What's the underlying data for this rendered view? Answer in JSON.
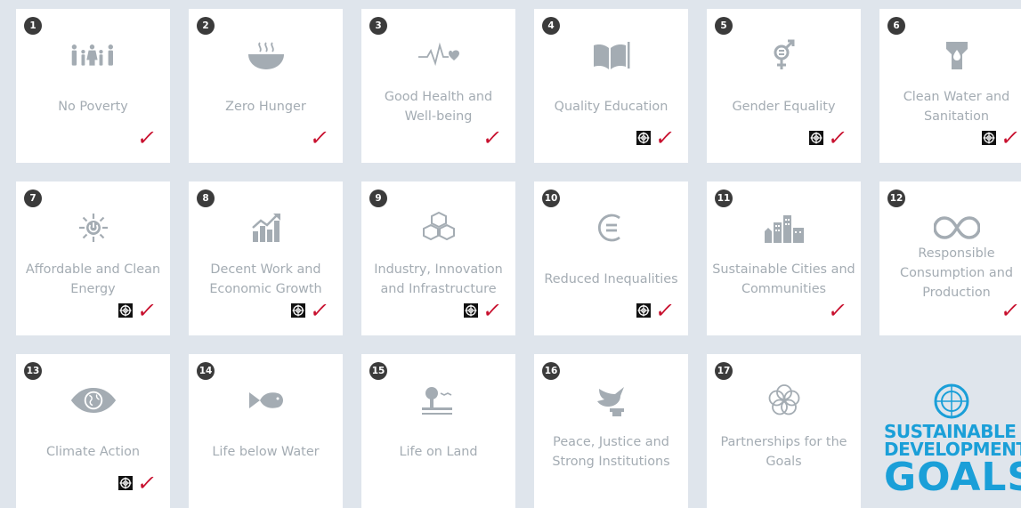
{
  "goals": [
    {
      "number": "1",
      "title": "No Poverty",
      "icon": "people-family-icon",
      "target": false,
      "check": true
    },
    {
      "number": "2",
      "title": "Zero Hunger",
      "icon": "food-bowl-icon",
      "target": false,
      "check": true
    },
    {
      "number": "3",
      "title": "Good Health and Well-being",
      "icon": "heartbeat-icon",
      "target": false,
      "check": true
    },
    {
      "number": "4",
      "title": "Quality Education",
      "icon": "book-icon",
      "target": true,
      "check": true
    },
    {
      "number": "5",
      "title": "Gender Equality",
      "icon": "gender-symbol-icon",
      "target": true,
      "check": true
    },
    {
      "number": "6",
      "title": "Clean Water and Sanitation",
      "icon": "water-drop-icon",
      "target": true,
      "check": true
    },
    {
      "number": "7",
      "title": "Affordable and Clean Energy",
      "icon": "sun-power-icon",
      "target": true,
      "check": true
    },
    {
      "number": "8",
      "title": "Decent Work and Economic Growth",
      "icon": "growth-chart-icon",
      "target": true,
      "check": true
    },
    {
      "number": "9",
      "title": "Industry, Innovation and Infrastructure",
      "icon": "cubes-icon",
      "target": true,
      "check": true
    },
    {
      "number": "10",
      "title": "Reduced Inequalities",
      "icon": "equal-sign-icon",
      "target": true,
      "check": true
    },
    {
      "number": "11",
      "title": "Sustainable Cities and Communities",
      "icon": "city-buildings-icon",
      "target": false,
      "check": true
    },
    {
      "number": "12",
      "title": "Responsible Consumption and Production",
      "icon": "infinity-loop-icon",
      "target": false,
      "check": true
    },
    {
      "number": "13",
      "title": "Climate Action",
      "icon": "eye-globe-icon",
      "target": true,
      "check": true
    },
    {
      "number": "14",
      "title": "Life below Water",
      "icon": "fish-icon",
      "target": false,
      "check": false
    },
    {
      "number": "15",
      "title": "Life on Land",
      "icon": "tree-bird-icon",
      "target": false,
      "check": false
    },
    {
      "number": "16",
      "title": "Peace, Justice and Strong Institutions",
      "icon": "dove-gavel-icon",
      "target": false,
      "check": false
    },
    {
      "number": "17",
      "title": "Partnerships for the Goals",
      "icon": "flower-rings-icon",
      "target": false,
      "check": false
    }
  ],
  "check_symbol": "✓",
  "logo": {
    "line1": "SUSTAINABLE",
    "line2": "DEVELOPMENT",
    "line3": "GOALS"
  },
  "colors": {
    "background": "#dfe5ec",
    "card": "#ffffff",
    "icon": "#a4acb3",
    "text": "#a4acb3",
    "badge": "#3b3b3b",
    "check": "#c8102e",
    "logo": "#1a9fd8"
  }
}
